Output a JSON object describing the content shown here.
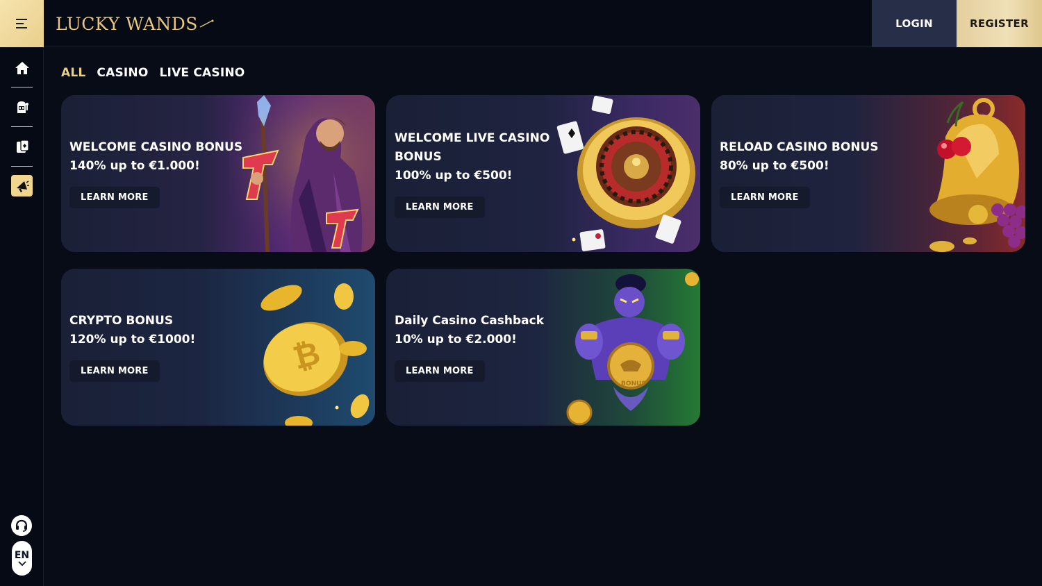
{
  "header": {
    "logo_text": "LUCKY WANDS",
    "login_label": "LOGIN",
    "register_label": "REGISTER",
    "menu_icon": "hamburger-icon"
  },
  "sidebar": {
    "items": [
      {
        "icon": "home-icon"
      },
      {
        "icon": "slot-machine-icon"
      },
      {
        "icon": "live-casino-cards-icon"
      },
      {
        "icon": "promotions-megaphone-icon",
        "active": true
      }
    ],
    "support_icon": "headset-icon",
    "language": "EN",
    "language_icon": "chevron-down-icon"
  },
  "filters": {
    "tabs": [
      {
        "label": "ALL",
        "active": true
      },
      {
        "label": "CASINO"
      },
      {
        "label": "LIVE CASINO"
      }
    ]
  },
  "promotions": [
    {
      "title": "WELCOME CASINO BONUS",
      "subtitle": "140% up to €1.000!",
      "button": "LEARN MORE",
      "art": "wizard-with-staff-art"
    },
    {
      "title": "WELCOME LIVE CASINO BONUS",
      "subtitle": "100% up to €500!",
      "button": "LEARN MORE",
      "art": "roulette-wheel-art"
    },
    {
      "title": "RELOAD CASINO BONUS",
      "subtitle": "80% up to €500!",
      "button": "LEARN MORE",
      "art": "golden-bell-cherries-art"
    },
    {
      "title": "CRYPTO BONUS",
      "subtitle": "120% up to €1000!",
      "button": "LEARN MORE",
      "art": "bitcoin-coins-art"
    },
    {
      "title": "Daily Casino Cashback",
      "subtitle": "10% up to €2.000!",
      "button": "LEARN MORE",
      "art": "genie-with-bonus-coin-art"
    }
  ],
  "colors": {
    "background": "#070c17",
    "accent_gold": "#ecd07f",
    "login_bg": "#262f47",
    "card_bg": "#1a2036"
  }
}
